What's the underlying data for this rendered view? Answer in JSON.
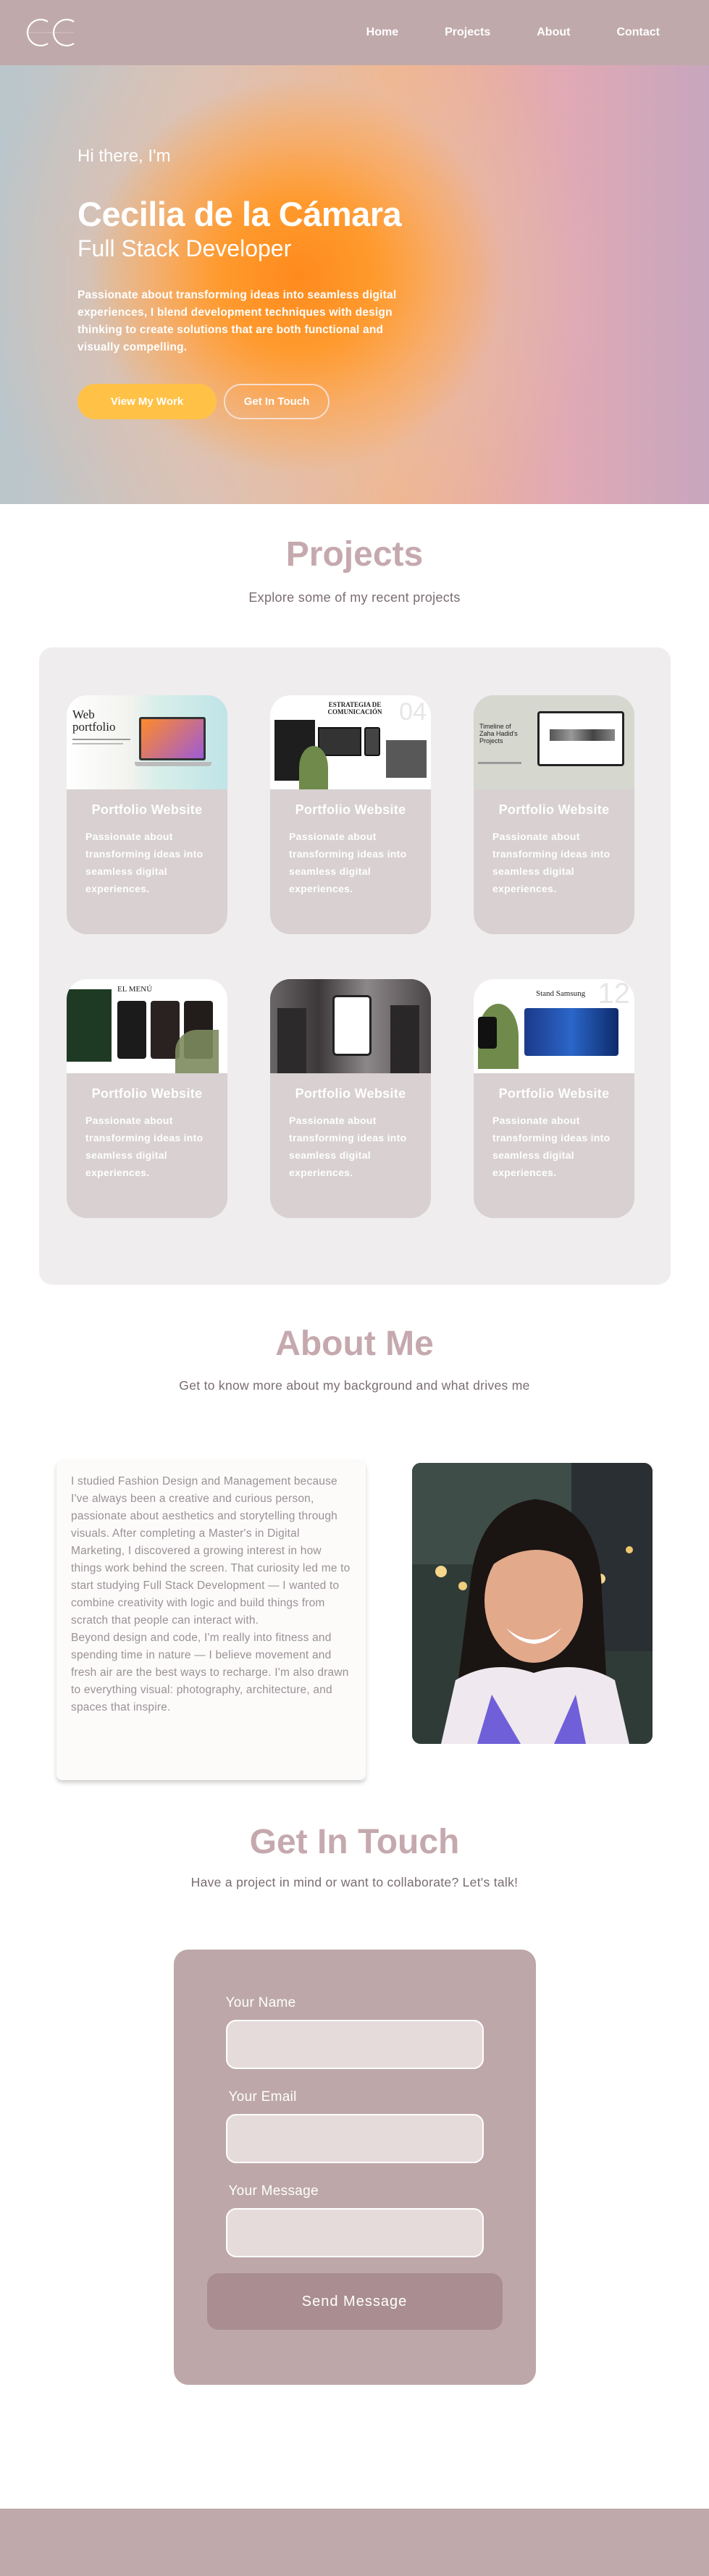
{
  "nav": {
    "logo_text": "CC",
    "links": [
      "Home",
      "Projects",
      "About",
      "Contact"
    ]
  },
  "hero": {
    "greeting": "Hi there, I'm",
    "name": "Cecilia de la Cámara",
    "role": "Full Stack Developer",
    "description": "Passionate about transforming ideas into seamless digital experiences, I blend development techniques with design thinking to create solutions that are both functional and visually compelling.",
    "primary_button": "View My Work",
    "secondary_button": "Get In Touch"
  },
  "projects": {
    "title": "Projects",
    "subtitle": "Explore some of my recent projects",
    "items": [
      {
        "title": "Portfolio Website",
        "description": "Passionate about transforming ideas into seamless digital experiences.",
        "thumb_text": "Web portfolio"
      },
      {
        "title": "Portfolio Website",
        "description": "Passionate about transforming ideas into seamless digital experiences.",
        "thumb_text": "ESTRATEGIA DE COMUNICACIÓN"
      },
      {
        "title": "Portfolio Website",
        "description": "Passionate about transforming ideas into seamless digital experiences.",
        "thumb_text": "Timeline of Zaha Hadid's Projects"
      },
      {
        "title": "Portfolio Website",
        "description": "Passionate about transforming ideas into seamless digital experiences.",
        "thumb_text": "EL MENÚ"
      },
      {
        "title": "Portfolio Website",
        "description": "Passionate about transforming ideas into seamless digital experiences.",
        "thumb_text": ""
      },
      {
        "title": "Portfolio Website",
        "description": "Passionate about transforming ideas into seamless digital experiences.",
        "thumb_text": "Stand Samsung"
      }
    ]
  },
  "about": {
    "title": "About Me",
    "subtitle": "Get to know more about my background and what drives me",
    "paragraph1": "I studied Fashion Design and Management because I've always been a creative and curious person, passionate about aesthetics and storytelling through visuals. After completing a Master's in Digital Marketing, I discovered a growing interest in how things work behind the screen. That curiosity led me to start studying Full Stack Development — I wanted to combine creativity with logic and build things from scratch that people can interact with.",
    "paragraph2": "Beyond design and code, I'm really into fitness and spending time in nature — I believe movement and fresh air are the best ways to recharge. I'm also drawn to everything visual: photography, architecture, and spaces that inspire."
  },
  "contact": {
    "title": "Get In Touch",
    "subtitle": "Have a project in mind or want to collaborate? Let's talk!",
    "name_label": "Your Name",
    "email_label": "Your Email",
    "message_label": "Your Message",
    "name_value": "",
    "email_value": "",
    "message_value": "",
    "submit_label": "Send Message"
  },
  "colors": {
    "nav_bg": "#c0a9aa",
    "accent": "#ffc247",
    "heading": "#c5a9ae",
    "card": "#d8d0d1",
    "form_bg": "#bda7a8"
  }
}
